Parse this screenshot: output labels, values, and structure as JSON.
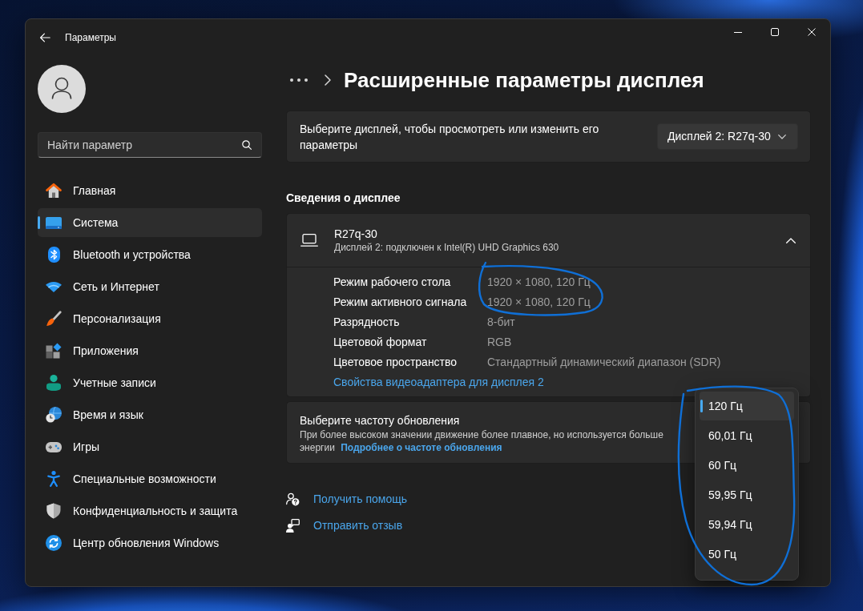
{
  "window": {
    "title": "Параметры"
  },
  "sidebar": {
    "search": {
      "placeholder": "Найти параметр"
    },
    "items": [
      {
        "kind": "home",
        "label": "Главная",
        "selected": false
      },
      {
        "kind": "system",
        "label": "Система",
        "selected": true
      },
      {
        "kind": "bluetooth",
        "label": "Bluetooth и устройства",
        "selected": false
      },
      {
        "kind": "network",
        "label": "Сеть и Интернет",
        "selected": false
      },
      {
        "kind": "personalization",
        "label": "Персонализация",
        "selected": false
      },
      {
        "kind": "apps",
        "label": "Приложения",
        "selected": false
      },
      {
        "kind": "accounts",
        "label": "Учетные записи",
        "selected": false
      },
      {
        "kind": "time",
        "label": "Время и язык",
        "selected": false
      },
      {
        "kind": "gaming",
        "label": "Игры",
        "selected": false
      },
      {
        "kind": "accessibility",
        "label": "Специальные возможности",
        "selected": false
      },
      {
        "kind": "privacy",
        "label": "Конфиденциальность и защита",
        "selected": false
      },
      {
        "kind": "update",
        "label": "Центр обновления Windows",
        "selected": false
      }
    ]
  },
  "page": {
    "title": "Расширенные параметры дисплея"
  },
  "display_select": {
    "label": "Выберите дисплей, чтобы просмотреть или изменить его параметры",
    "value": "Дисплей 2: R27q-30"
  },
  "display_info": {
    "heading": "Сведения о дисплее",
    "name": "R27q-30",
    "subtitle": "Дисплей 2: подключен к Intel(R) UHD Graphics 630",
    "expanded": true,
    "rows": [
      {
        "label": "Режим рабочего стола",
        "value": "1920 × 1080, 120 Гц"
      },
      {
        "label": "Режим активного сигнала",
        "value": "1920 × 1080, 120 Гц"
      },
      {
        "label": "Разрядность",
        "value": "8-бит"
      },
      {
        "label": "Цветовой формат",
        "value": "RGB"
      },
      {
        "label": "Цветовое пространство",
        "value": "Стандартный динамический диапазон (SDR)"
      }
    ],
    "link": "Свойства видеоадаптера для дисплея 2"
  },
  "refresh_rate": {
    "title": "Выберите частоту обновления",
    "description": "При более высоком значении движение более плавное, но используется больше энергии",
    "link": "Подробнее о частоте обновления",
    "menu": [
      {
        "label": "120 Гц",
        "selected": true
      },
      {
        "label": "60,01 Гц",
        "selected": false
      },
      {
        "label": "60 Гц",
        "selected": false
      },
      {
        "label": "59,95 Гц",
        "selected": false
      },
      {
        "label": "59,94 Гц",
        "selected": false
      },
      {
        "label": "50 Гц",
        "selected": false
      }
    ]
  },
  "help_links": [
    {
      "kind": "help",
      "label": "Получить помощь"
    },
    {
      "kind": "feedback",
      "label": "Отправить отзыв"
    }
  ]
}
